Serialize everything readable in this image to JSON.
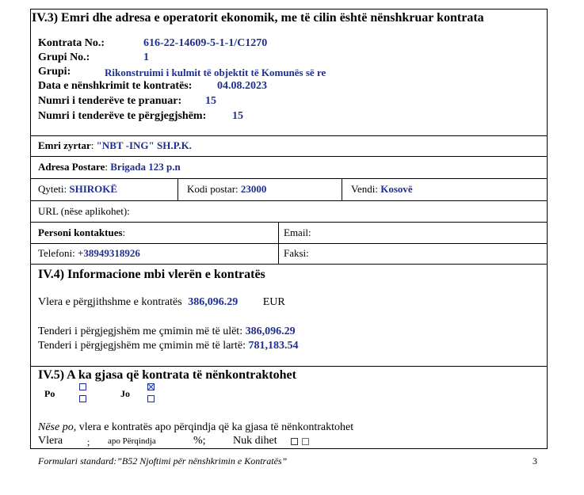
{
  "section_iv3": {
    "title": "IV.3) Emri dhe adresa e operatorit ekonomik, me të cilin është nënshkruar kontrata",
    "contract_no_label": "Kontrata No.:",
    "contract_no": "616-22-14609-5-1-1/C1270",
    "group_no_label": "Grupi No.:",
    "group_no": "1",
    "group_label": "Grupi:",
    "group": "Rikonstruimi i kulmit të objektit të Komunës së re",
    "signing_date_label": "Data e nënshkrimit te kontratës:",
    "signing_date": "04.08.2023",
    "tenders_received_label": "Numri i tenderëve te pranuar:",
    "tenders_received": "15",
    "tenders_responsive_label": "Numri i tenderëve te përgjegjshëm:",
    "tenders_responsive": "15"
  },
  "operator": {
    "official_name_label": "Emri zyrtar",
    "official_name": "\"NBT -ING\" SH.P.K.",
    "postal_address_label": "Adresa Postare",
    "postal_address": "Brigada 123 p.n",
    "city_label": "Qyteti:",
    "city": "SHIROKË",
    "postal_code_label": "Kodi postar:",
    "postal_code": "23000",
    "country_label": "Vendi:",
    "country": "Kosovë",
    "url_label": "URL (nëse aplikohet):",
    "contact_person_label": "Personi kontaktues",
    "email_label": "Email:",
    "phone_label": "Telefoni:",
    "phone": "+38949318926",
    "fax_label": "Faksi:"
  },
  "section_iv4": {
    "title": "IV.4) Informacione mbi vlerën e kontratës",
    "total_value_label": "Vlera e përgjithshme e kontratës",
    "total_value": "386,096.29",
    "currency": "EUR",
    "lowest_label": "Tenderi i përgjegjshëm me çmimin më të ulët:",
    "lowest": "386,096.29",
    "highest_label": "Tenderi i përgjegjshëm me çmimin më të lartë:",
    "highest": "781,183.54"
  },
  "section_iv5": {
    "title": "IV.5) A ka gjasa që kontrata të nënkontraktohet",
    "yes_label": "Po",
    "no_label": "Jo",
    "if_yes_italic": "Nëse po,",
    "if_yes_text": "vlera e kontratës apo përqindja që ka gjasa të nënkontraktohet",
    "value_label": "Vlera",
    "semicolon": ";",
    "percent_label": "apo Përqindja",
    "percent_sign": "%;",
    "unknown_label": "Nuk dihet"
  },
  "footer": {
    "form_name": "Formulari standard:”B52 Njoftimi për nënshkrimin e Kontratës”",
    "page_number": "3"
  }
}
